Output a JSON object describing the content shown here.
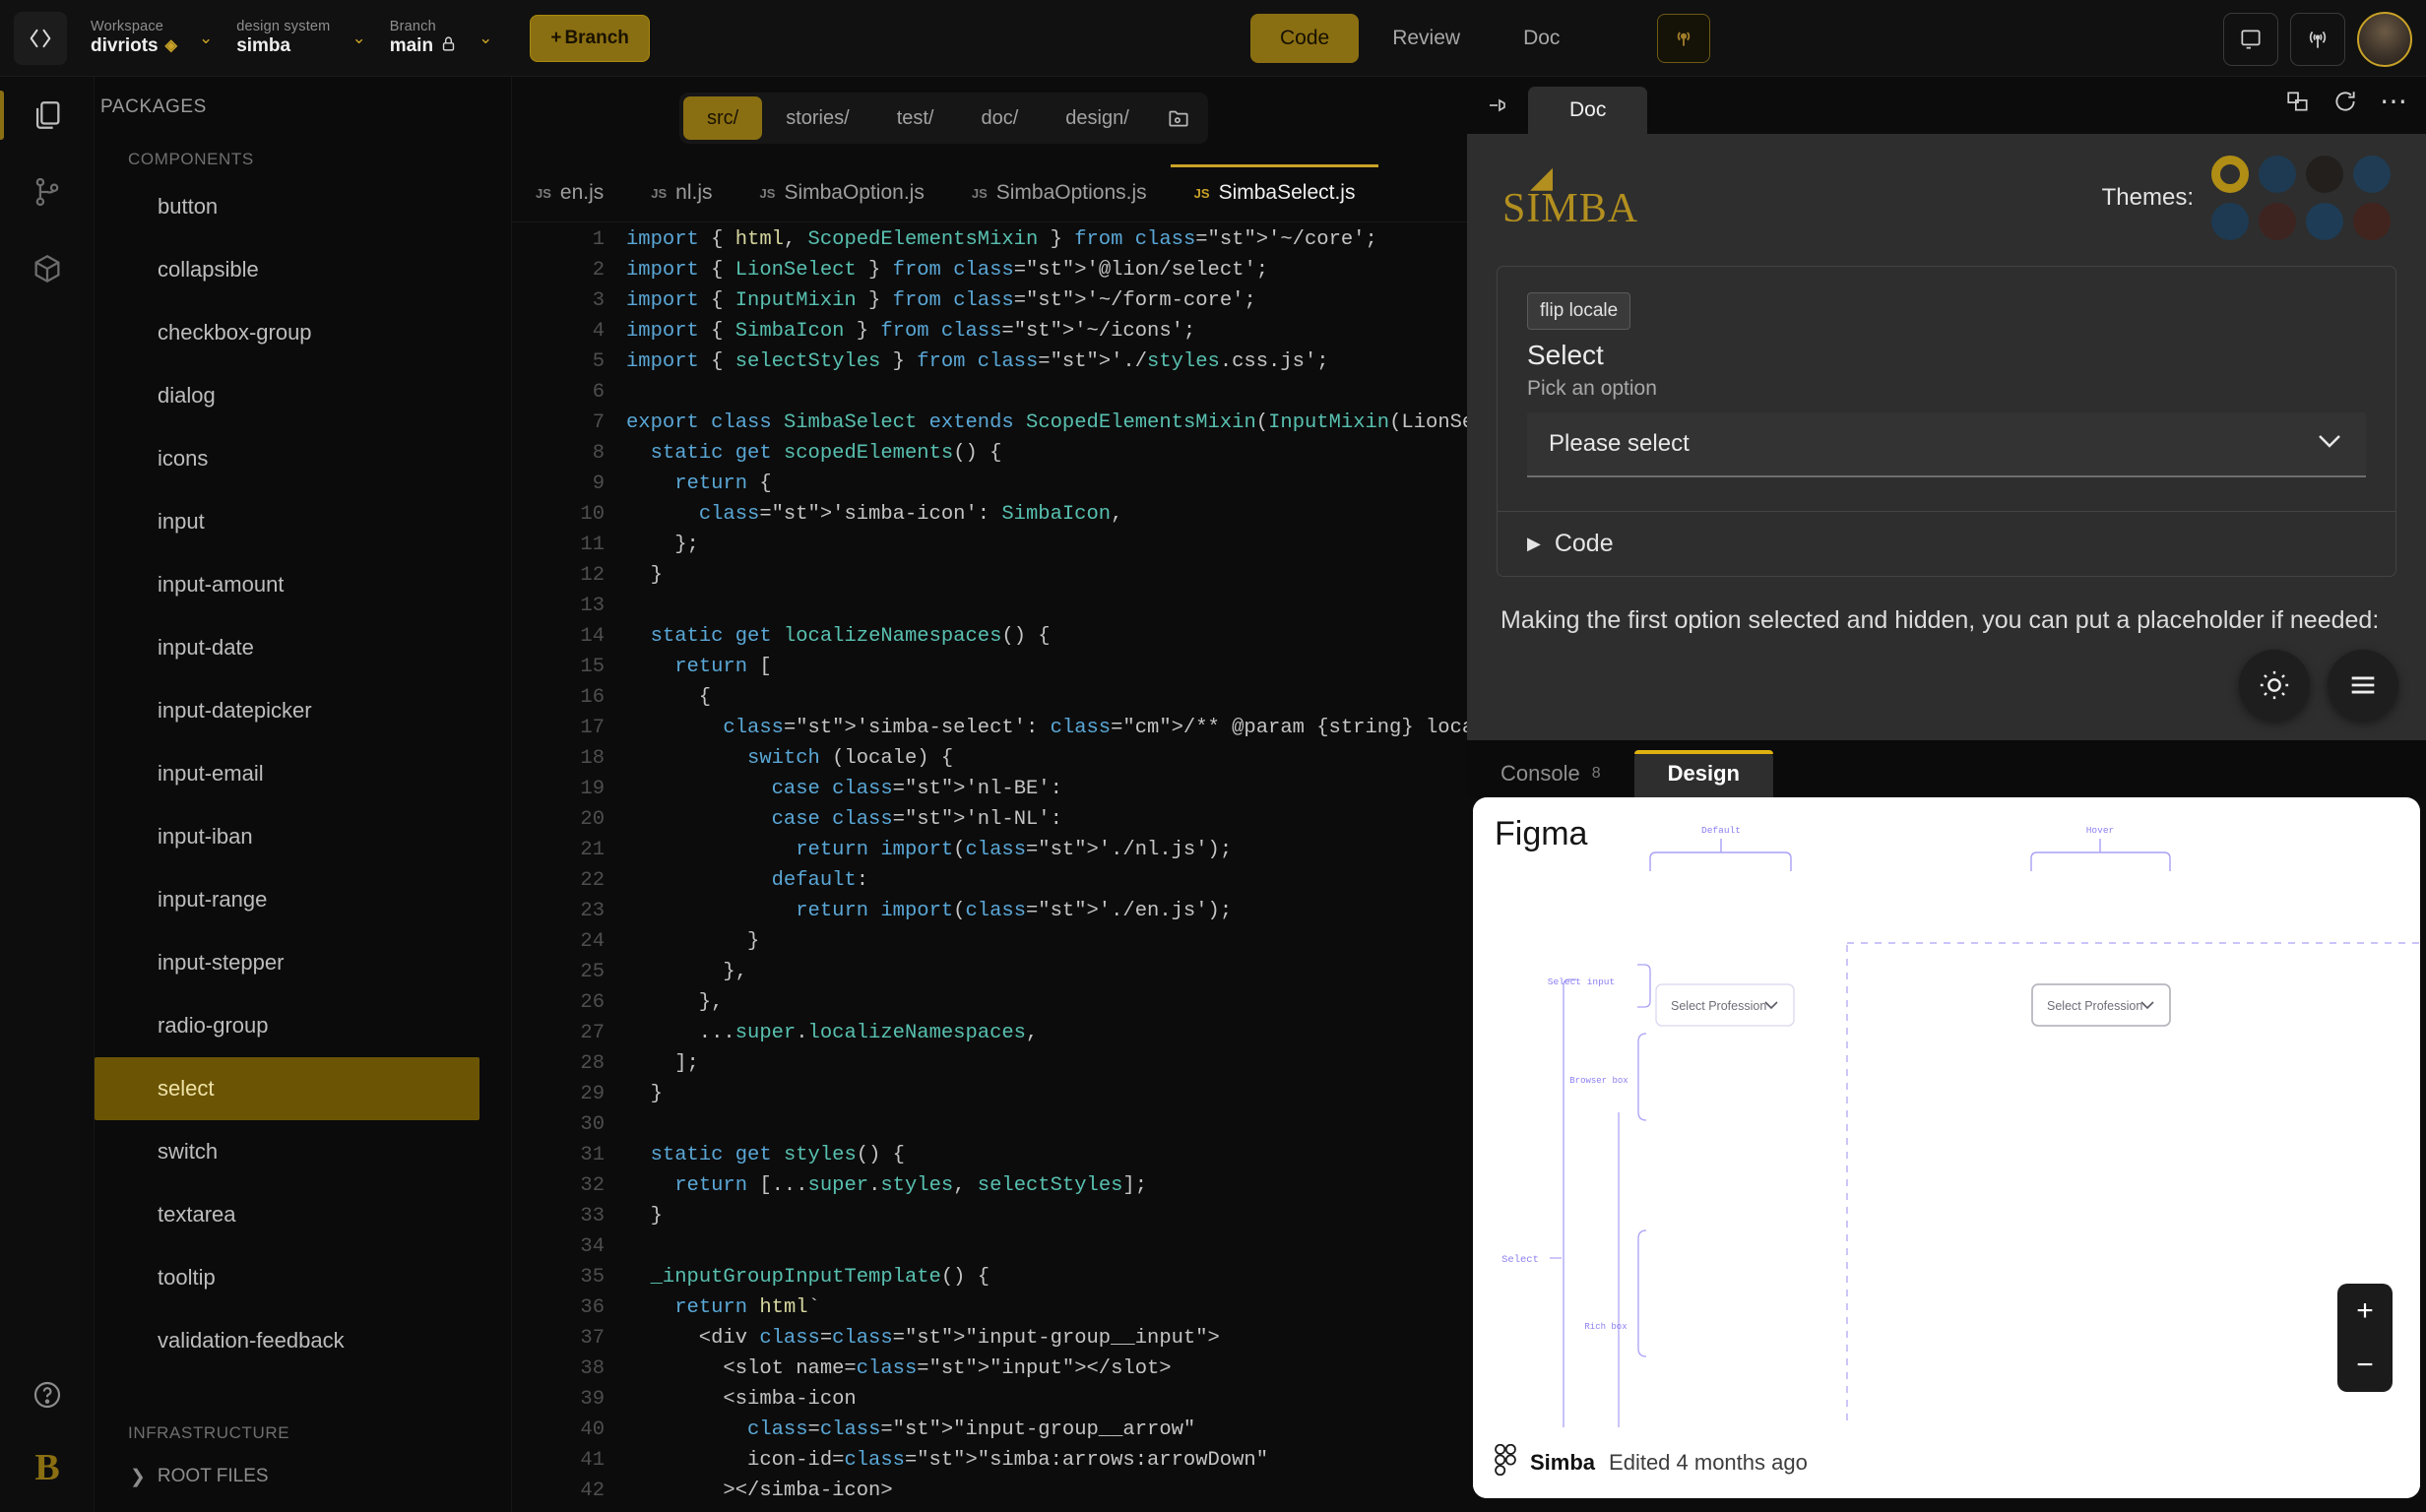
{
  "topbar": {
    "logo_icon": "code-brackets-icon",
    "workspace": {
      "label": "Workspace",
      "value": "divriots",
      "badge_icon": "diamond-icon",
      "chevron_icon": "chevron-down-icon"
    },
    "design_system": {
      "label": "design system",
      "value": "simba",
      "chevron_icon": "chevron-down-icon"
    },
    "branch": {
      "label": "Branch",
      "value": "main",
      "lock_icon": "lock-icon",
      "chevron_icon": "chevron-down-icon"
    },
    "new_branch_button": "Branch",
    "new_branch_plus": "+",
    "mode_tabs": [
      {
        "label": "Code",
        "active": true
      },
      {
        "label": "Review",
        "active": false
      },
      {
        "label": "Doc",
        "active": false
      }
    ],
    "broadcast_icon": "broadcast-icon",
    "right_icons": [
      "device-preview-icon",
      "antenna-icon"
    ],
    "avatar_icon": "user-avatar"
  },
  "rail": {
    "items": [
      {
        "icon": "packages-files-icon",
        "active": true
      },
      {
        "icon": "git-branch-icon",
        "active": false
      },
      {
        "icon": "package-cube-icon",
        "active": false
      }
    ],
    "help_icon": "help-circle-icon",
    "brand_mark": "B"
  },
  "sidebar": {
    "title": "PACKAGES",
    "section_components": "COMPONENTS",
    "components": [
      {
        "label": "button"
      },
      {
        "label": "collapsible"
      },
      {
        "label": "checkbox-group"
      },
      {
        "label": "dialog"
      },
      {
        "label": "icons"
      },
      {
        "label": "input"
      },
      {
        "label": "input-amount"
      },
      {
        "label": "input-date"
      },
      {
        "label": "input-datepicker"
      },
      {
        "label": "input-email"
      },
      {
        "label": "input-iban"
      },
      {
        "label": "input-range"
      },
      {
        "label": "input-stepper"
      },
      {
        "label": "radio-group"
      },
      {
        "label": "select"
      },
      {
        "label": "switch"
      },
      {
        "label": "textarea"
      },
      {
        "label": "tooltip"
      },
      {
        "label": "validation-feedback"
      }
    ],
    "selected_component": "select",
    "section_infrastructure": "INFRASTRUCTURE",
    "root_files": "ROOT FILES",
    "root_files_chevron": "chevron-right-icon"
  },
  "editor": {
    "dir_tabs": [
      {
        "label": "src/",
        "active": true
      },
      {
        "label": "stories/",
        "active": false
      },
      {
        "label": "test/",
        "active": false
      },
      {
        "label": "doc/",
        "active": false
      },
      {
        "label": "design/",
        "active": false
      }
    ],
    "dir_extra_icon": "folder-settings-icon",
    "file_tabs": [
      {
        "prefix": "JS",
        "label": "en.js",
        "active": false
      },
      {
        "prefix": "JS",
        "label": "nl.js",
        "active": false
      },
      {
        "prefix": "JS",
        "label": "SimbaOption.js",
        "active": false
      },
      {
        "prefix": "JS",
        "label": "SimbaOptions.js",
        "active": false
      },
      {
        "prefix": "JS",
        "label": "SimbaSelect.js",
        "active": true
      }
    ],
    "help_badge": "?",
    "code_lines": [
      {
        "n": 1,
        "text": "import { html, ScopedElementsMixin } from '~/core';"
      },
      {
        "n": 2,
        "text": "import { LionSelect } from '@lion/select';"
      },
      {
        "n": 3,
        "text": "import { InputMixin } from '~/form-core';"
      },
      {
        "n": 4,
        "text": "import { SimbaIcon } from '~/icons';"
      },
      {
        "n": 5,
        "text": "import { selectStyles } from './styles.css.js';"
      },
      {
        "n": 6,
        "text": ""
      },
      {
        "n": 7,
        "text": "export class SimbaSelect extends ScopedElementsMixin(InputMixin(LionSe"
      },
      {
        "n": 8,
        "text": "  static get scopedElements() {"
      },
      {
        "n": 9,
        "text": "    return {"
      },
      {
        "n": 10,
        "text": "      'simba-icon': SimbaIcon,"
      },
      {
        "n": 11,
        "text": "    };"
      },
      {
        "n": 12,
        "text": "  }"
      },
      {
        "n": 13,
        "text": ""
      },
      {
        "n": 14,
        "text": "  static get localizeNamespaces() {"
      },
      {
        "n": 15,
        "text": "    return ["
      },
      {
        "n": 16,
        "text": "      {"
      },
      {
        "n": 17,
        "text": "        'simba-select': /** @param {string} locale */ (locale) => {"
      },
      {
        "n": 18,
        "text": "          switch (locale) {"
      },
      {
        "n": 19,
        "text": "            case 'nl-BE':"
      },
      {
        "n": 20,
        "text": "            case 'nl-NL':"
      },
      {
        "n": 21,
        "text": "              return import('./nl.js');"
      },
      {
        "n": 22,
        "text": "            default:"
      },
      {
        "n": 23,
        "text": "              return import('./en.js');"
      },
      {
        "n": 24,
        "text": "          }"
      },
      {
        "n": 25,
        "text": "        },"
      },
      {
        "n": 26,
        "text": "      },"
      },
      {
        "n": 27,
        "text": "      ...super.localizeNamespaces,"
      },
      {
        "n": 28,
        "text": "    ];"
      },
      {
        "n": 29,
        "text": "  }"
      },
      {
        "n": 30,
        "text": ""
      },
      {
        "n": 31,
        "text": "  static get styles() {"
      },
      {
        "n": 32,
        "text": "    return [...super.styles, selectStyles];"
      },
      {
        "n": 33,
        "text": "  }"
      },
      {
        "n": 34,
        "text": ""
      },
      {
        "n": 35,
        "text": "  _inputGroupInputTemplate() {"
      },
      {
        "n": 36,
        "text": "    return html`"
      },
      {
        "n": 37,
        "text": "      <div class=\"input-group__input\">"
      },
      {
        "n": 38,
        "text": "        <slot name=\"input\"></slot>"
      },
      {
        "n": 39,
        "text": "        <simba-icon"
      },
      {
        "n": 40,
        "text": "          class=\"input-group__arrow\""
      },
      {
        "n": 41,
        "text": "          icon-id=\"simba:arrows:arrowDown\""
      },
      {
        "n": 42,
        "text": "        ></simba-icon>"
      }
    ]
  },
  "doc_panel": {
    "pin_icon": "pin-icon",
    "tab_label": "Doc",
    "tools": [
      "split-panel-icon",
      "refresh-icon",
      "more-options-icon"
    ],
    "brand": "SIMBA",
    "themes_label": "Themes:",
    "theme_swatches": [
      {
        "color": "#b08d14",
        "selected": true
      },
      {
        "color": "#1e3a52",
        "selected": false
      },
      {
        "color": "#221f1d",
        "selected": false
      },
      {
        "color": "#1f3c54",
        "selected": false
      },
      {
        "color": "#1d3a52",
        "selected": false
      },
      {
        "color": "#3e2420",
        "selected": false
      },
      {
        "color": "#1e3c55",
        "selected": false
      },
      {
        "color": "#42241e",
        "selected": false
      }
    ],
    "demo": {
      "flip_locale_button": "flip locale",
      "title": "Select",
      "helper": "Pick an option",
      "select_value": "Please select",
      "select_chevron": "chevron-down-icon",
      "code_toggle": "Code",
      "code_caret": "caret-right-icon"
    },
    "paragraph": "Making the first option selected and hidden, you can put a placeholder if needed:",
    "fabs": [
      "theme-sun-icon",
      "menu-hamburger-icon"
    ]
  },
  "bottom_panel": {
    "tabs": [
      {
        "label": "Console",
        "count": "8",
        "active": false
      },
      {
        "label": "Design",
        "count": "",
        "active": true
      }
    ]
  },
  "figma": {
    "title": "Figma",
    "annotations": {
      "default": "Default",
      "hover": "Hover",
      "select_input": "Select input",
      "browser_box": "Browser box",
      "select": "Select",
      "rich_box": "Rich box"
    },
    "select_default_label": "Select Profession",
    "select_hover_label": "Select Profession",
    "select_chevron": "chevron-down-icon",
    "zoom_in": "+",
    "zoom_out": "−",
    "footer_icon": "figma-logo-icon",
    "footer_name": "Simba",
    "footer_meta": "Edited 4 months ago"
  }
}
